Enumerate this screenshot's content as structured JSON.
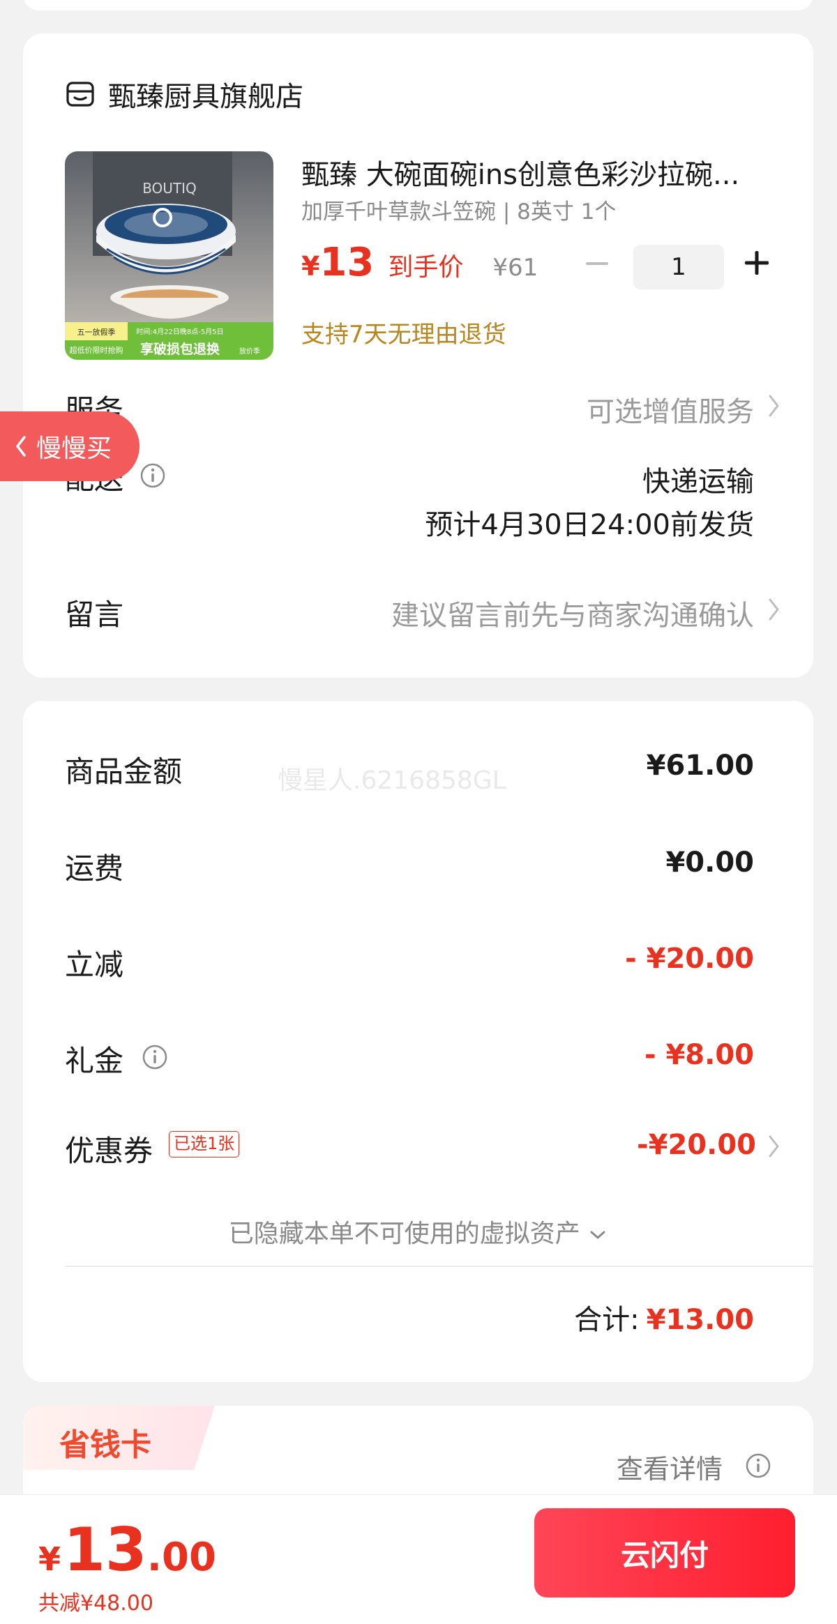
{
  "shop": {
    "name": "甄臻厨具旗舰店"
  },
  "product": {
    "title": "甄臻 大碗面碗ins创意色彩沙拉碗...",
    "spec": "加厚千叶草款斗笠碗 | 8英寸 1个",
    "price_yen": "¥",
    "price": "13",
    "price_label": "到手价",
    "original_price": "¥61",
    "quantity": "1",
    "return_policy": "支持7天无理由退货",
    "image_text": {
      "brand": "BOUTIQ",
      "banner_left_top": "五一放假季",
      "banner_left_bottom": "超低价限时抢购",
      "banner_right_top": "时间:4月22日晚8点-5月5日",
      "banner_right_bottom": "享破损包退换",
      "banner_badge": "放价季"
    }
  },
  "service": {
    "label": "服务",
    "value": "可选增值服务"
  },
  "delivery": {
    "label": "配送",
    "method": "快递运输",
    "estimate": "预计4月30日24:00前发货"
  },
  "message": {
    "label": "留言",
    "placeholder": "建议留言前先与商家沟通确认"
  },
  "floating_tag": {
    "label": "慢慢买"
  },
  "amounts": {
    "watermark": "慢星人.6216858GL",
    "goods_label": "商品金额",
    "goods_value": "¥61.00",
    "shipping_label": "运费",
    "shipping_value": "¥0.00",
    "instant_label": "立减",
    "instant_value": "- ¥20.00",
    "gift_label": "礼金",
    "gift_value": "- ¥8.00",
    "coupon_label": "优惠券",
    "coupon_badge": "已选1张",
    "coupon_value": "-¥20.00",
    "hidden_assets": "已隐藏本单不可使用的虚拟资产",
    "total_label": "合计:",
    "total_value": "¥13.00"
  },
  "saver_card": {
    "title": "省钱卡",
    "detail": "查看详情"
  },
  "bottom_bar": {
    "yen": "¥",
    "amount_int": "13",
    "amount_dec": ".00",
    "saved": "共减¥48.00",
    "pay_button": "云闪付"
  },
  "colors": {
    "accent_red": "#e8321f",
    "gold_text": "#b8861b",
    "pay_button": "#ff2a3a",
    "float_tag": "#f25a5c"
  }
}
